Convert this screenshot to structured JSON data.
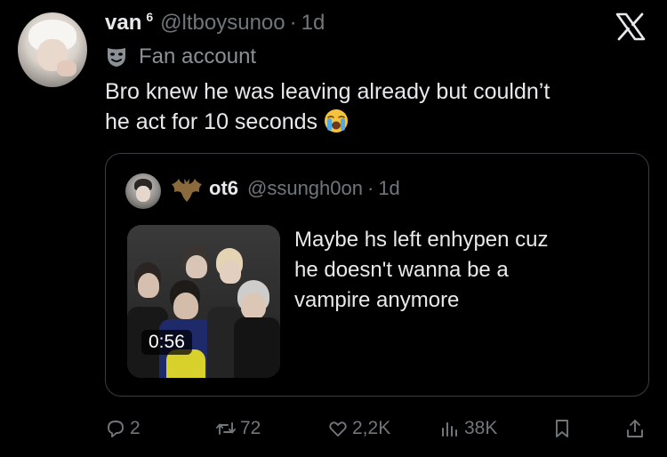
{
  "tweet": {
    "author_name": "van",
    "author_badge": "6",
    "author_handle": "@ltboysunoo",
    "separator": "·",
    "time": "1d",
    "label_icon": "mask-icon",
    "label": "Fan account",
    "text_lines": [
      "Bro knew he was leaving already but couldn’t",
      "he act for 10 seconds"
    ],
    "emoji": "loudly-crying-face"
  },
  "quoted": {
    "author_name": "ot6",
    "author_handle": "@ssungh0on",
    "separator": "·",
    "time": "1d",
    "badge_icon": "bat-icon",
    "video_duration": "0:56",
    "text_lines": [
      "Maybe hs left enhypen cuz",
      "he doesn't wanna be a",
      "vampire anymore"
    ]
  },
  "actions": {
    "replies": "2",
    "retweets": "72",
    "likes": "2,2K",
    "views": "38K"
  },
  "colors": {
    "background": "#000000",
    "text": "#e7e9ea",
    "secondary": "#71767b",
    "border": "#3a3d41"
  }
}
